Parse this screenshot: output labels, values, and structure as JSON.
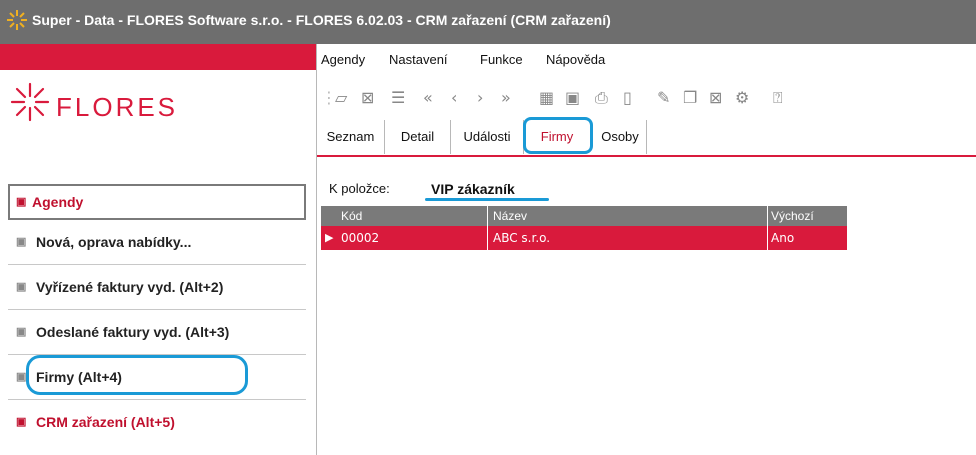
{
  "window": {
    "title": "Super - Data - FLORES Software  s.r.o. - FLORES 6.02.03 - CRM zařazení  (CRM zařazení)"
  },
  "brand": {
    "name": "FLORES"
  },
  "sidebar": {
    "items": [
      {
        "label": "Agendy"
      },
      {
        "label": "Nová, oprava nabídky..."
      },
      {
        "label": "Vyřízené faktury vyd. (Alt+2)"
      },
      {
        "label": "Odeslané faktury vyd. (Alt+3)"
      },
      {
        "label": "Firmy (Alt+4)"
      },
      {
        "label": "CRM zařazení (Alt+5)"
      }
    ]
  },
  "menu": {
    "items": [
      "Agendy",
      "Nastavení",
      "Funkce",
      "Nápověda"
    ]
  },
  "toolbar": {
    "icons": [
      "open-icon",
      "close-icon",
      "columns-icon",
      "first-icon",
      "prev-icon",
      "next-icon",
      "last-icon",
      "export-icon",
      "save-icon",
      "print-icon",
      "new-icon",
      "edit-icon",
      "copy-icon",
      "delete-icon",
      "settings-icon",
      "help-icon"
    ]
  },
  "tabs": [
    {
      "label": "Seznam"
    },
    {
      "label": "Detail"
    },
    {
      "label": "Události"
    },
    {
      "label": "Firmy"
    },
    {
      "label": "Osoby"
    }
  ],
  "context": {
    "label": "K položce:",
    "value": "VIP zákazník"
  },
  "grid": {
    "columns": [
      "Kód",
      "Název",
      "Výchozí"
    ],
    "rows": [
      {
        "kod": "00002",
        "nazev": "ABC s.r.o.",
        "vychozi": "Ano"
      }
    ]
  },
  "colors": {
    "accent": "#d91a3c",
    "highlight": "#1a9ad6",
    "titlebar": "#6e6e6e"
  }
}
